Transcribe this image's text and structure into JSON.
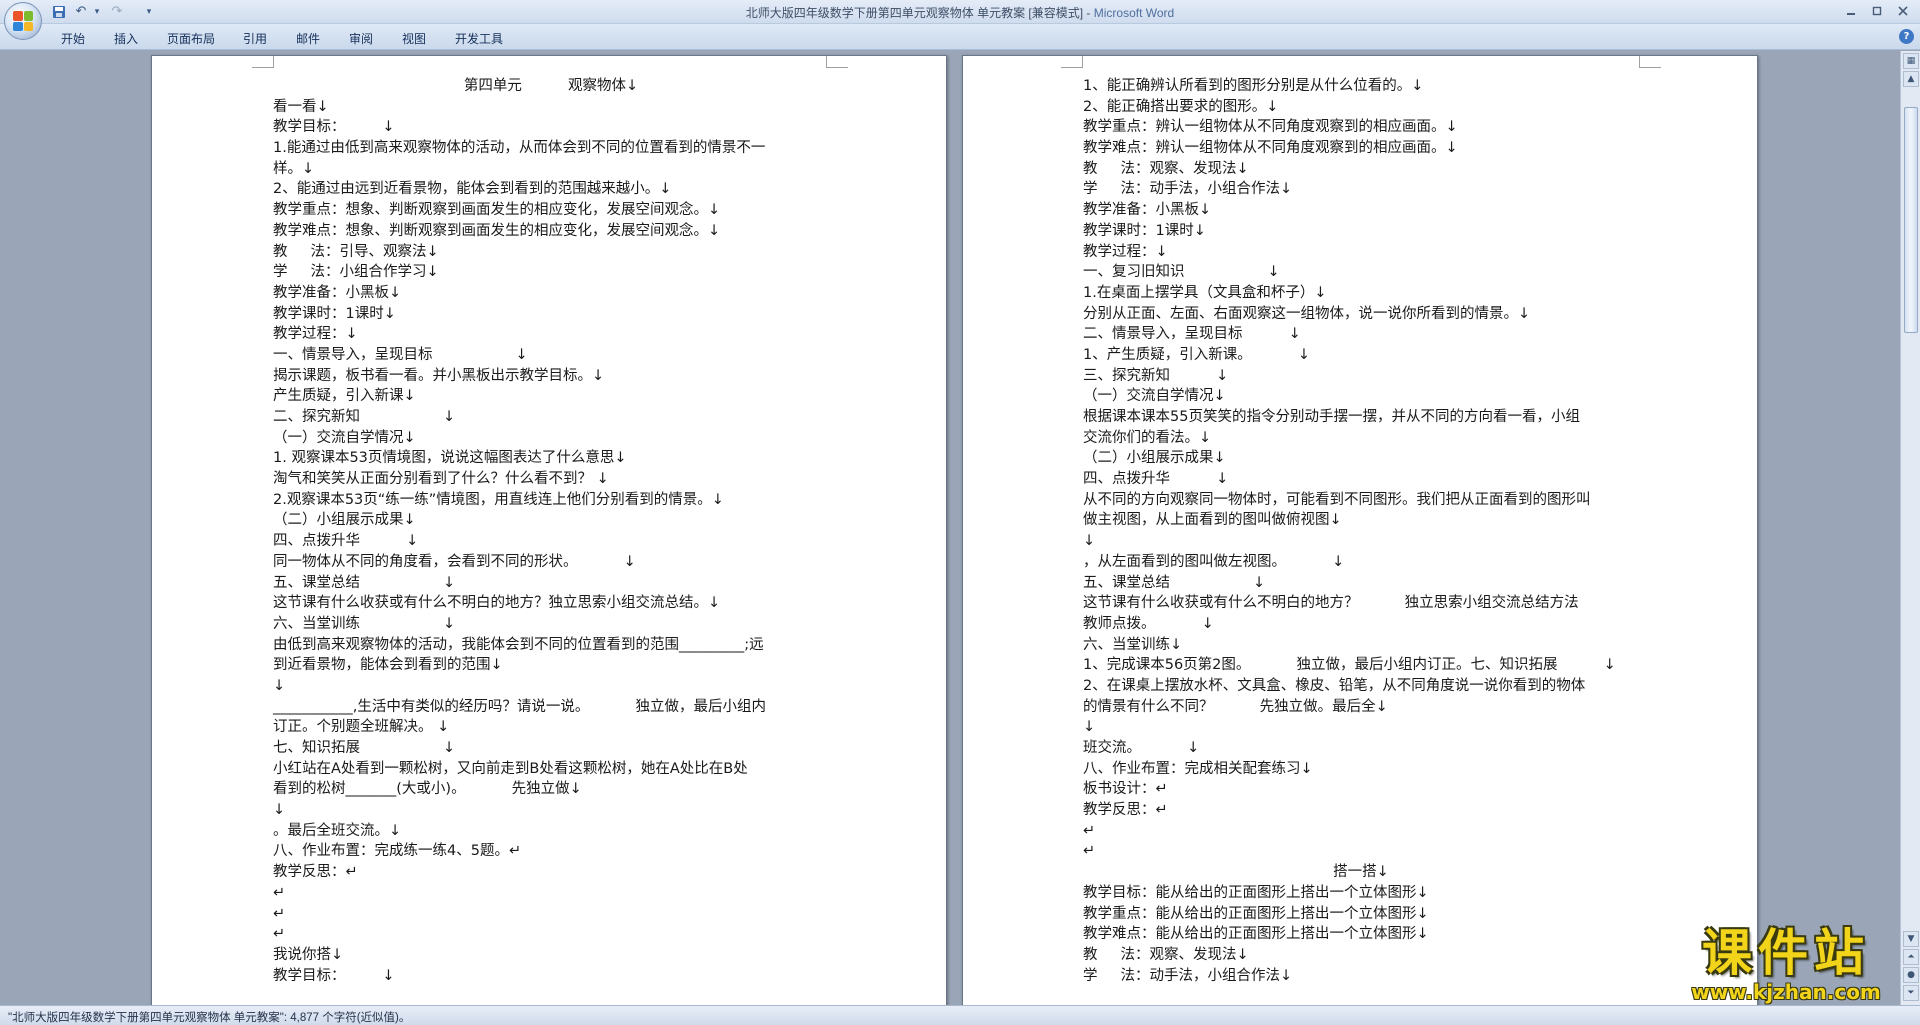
{
  "window": {
    "title": "北师大版四年级数学下册第四单元观察物体    单元教案 [兼容模式]",
    "app_name": "Microsoft Word",
    "title_separator": " - "
  },
  "quick_access": {
    "save_icon": "save-icon",
    "undo_icon": "undo-icon",
    "redo_icon": "redo-icon",
    "customize_icon": "chevron-down-icon"
  },
  "ribbon": {
    "tabs": [
      "开始",
      "插入",
      "页面布局",
      "引用",
      "邮件",
      "审阅",
      "视图",
      "开发工具"
    ]
  },
  "document": {
    "left_page": [
      "第四单元          观察物体↓",
      "看一看↓",
      "教学目标：        ↓",
      "1.能通过由低到高来观察物体的活动，从而体会到不同的位置看到的情景不一",
      "样。↓",
      "2、能通过由远到近看景物，能体会到看到的范围越来越小。↓",
      "教学重点：想象、判断观察到画面发生的相应变化，发展空间观念。↓",
      "教学难点：想象、判断观察到画面发生的相应变化，发展空间观念。↓",
      "教     法：引导、观察法↓",
      "学     法：小组合作学习↓",
      "教学准备：小黑板↓",
      "教学课时：1课时↓",
      "教学过程：↓",
      "一、情景导入，呈现目标                  ↓",
      "揭示课题，板书看一看。并小黑板出示教学目标。↓",
      "产生质疑，引入新课↓",
      "二、探究新知                  ↓",
      "（一）交流自学情况↓",
      "1. 观察课本53页情境图，说说这幅图表达了什么意思↓",
      "淘气和笑笑从正面分别看到了什么？什么看不到？ ↓",
      "2.观察课本53页“练一练”情境图，用直线连上他们分别看到的情景。↓",
      "（二）小组展示成果↓",
      "四、点拨升华          ↓",
      "同一物体从不同的角度看，会看到不同的形状。          ↓",
      "五、课堂总结                  ↓",
      "这节课有什么收获或有什么不明白的地方？独立思索小组交流总结。↓",
      "六、当堂训练                  ↓",
      "由低到高来观察物体的活动，我能体会到不同的位置看到的范围_________;远",
      "到近看景物，能体会到看到的范围↓",
      "↓",
      "___________,生活中有类似的经历吗？请说一说。          独立做，最后小组内",
      "订正。个别题全班解决。 ↓",
      "七、知识拓展                  ↓",
      "小红站在A处看到一颗松树，又向前走到B处看这颗松树，她在A处比在B处",
      "看到的松树_______(大或小)。          先独立做↓",
      "↓",
      "。最后全班交流。↓",
      "八、作业布置：完成练一练4、5题。↵",
      "教学反思：↵",
      "↵",
      "↵",
      "↵",
      "我说你搭↓",
      "教学目标：        ↓"
    ],
    "right_page": [
      "1、能正确辨认所看到的图形分别是从什么位看的。↓",
      "2、能正确搭出要求的图形。↓",
      "教学重点：辨认一组物体从不同角度观察到的相应画面。↓",
      "教学难点：辨认一组物体从不同角度观察到的相应画面。↓",
      "教     法：观察、发现法↓",
      "学     法：动手法，小组合作法↓",
      "教学准备：小黑板↓",
      "教学课时：1课时↓",
      "教学过程：↓",
      "一、复习旧知识                  ↓",
      "1.在桌面上摆学具（文具盒和杯子）↓",
      "分别从正面、左面、右面观察这一组物体，说一说你所看到的情景。↓",
      "二、情景导入，呈现目标          ↓",
      "1、产生质疑，引入新课。          ↓",
      "三、探究新知          ↓",
      "（一）交流自学情况↓",
      "根据课本课本55页笑笑的指令分别动手摆一摆，并从不同的方向看一看，小组",
      "交流你们的看法。↓",
      "（二）小组展示成果↓",
      "四、点拨升华          ↓",
      "从不同的方向观察同一物体时，可能看到不同图形。我们把从正面看到的图形叫",
      "做主视图，从上面看到的图叫做俯视图↓",
      "↓",
      "，从左面看到的图叫做左视图。          ↓",
      "五、课堂总结                  ↓",
      "这节课有什么收获或有什么不明白的地方？          独立思索小组交流总结方法",
      "教师点拨。          ↓",
      "六、当堂训练↓",
      "1、完成课本56页第2图。          独立做，最后小组内订正。七、知识拓展          ↓",
      "2、在课桌上摆放水杯、文具盒、橡皮、铅笔，从不同角度说一说你看到的物体",
      "的情景有什么不同？          先独立做。最后全↓",
      "↓",
      "班交流。          ↓",
      "八、作业布置：完成相关配套练习↓",
      "板书设计：↵",
      "教学反思：↵",
      "↵",
      "↵",
      "搭一搭↓",
      "教学目标：能从给出的正面图形上搭出一个立体图形↓",
      "教学重点：能从给出的正面图形上搭出一个立体图形↓",
      "教学难点：能从给出的正面图形上搭出一个立体图形↓",
      "教     法：观察、发现法↓",
      "学     法：动手法，小组合作法↓"
    ]
  },
  "status_bar": {
    "text": "\"北师大版四年级数学下册第四单元观察物体    单元教案\": 4,877 个字符(近似值)。"
  },
  "watermark": {
    "title": "课件站",
    "url": "www.kjzhan.com"
  },
  "colors": {
    "accent": "#4f6f9e",
    "page_bg": "#ffffff",
    "workspace_bg": "#9aa6b7"
  }
}
